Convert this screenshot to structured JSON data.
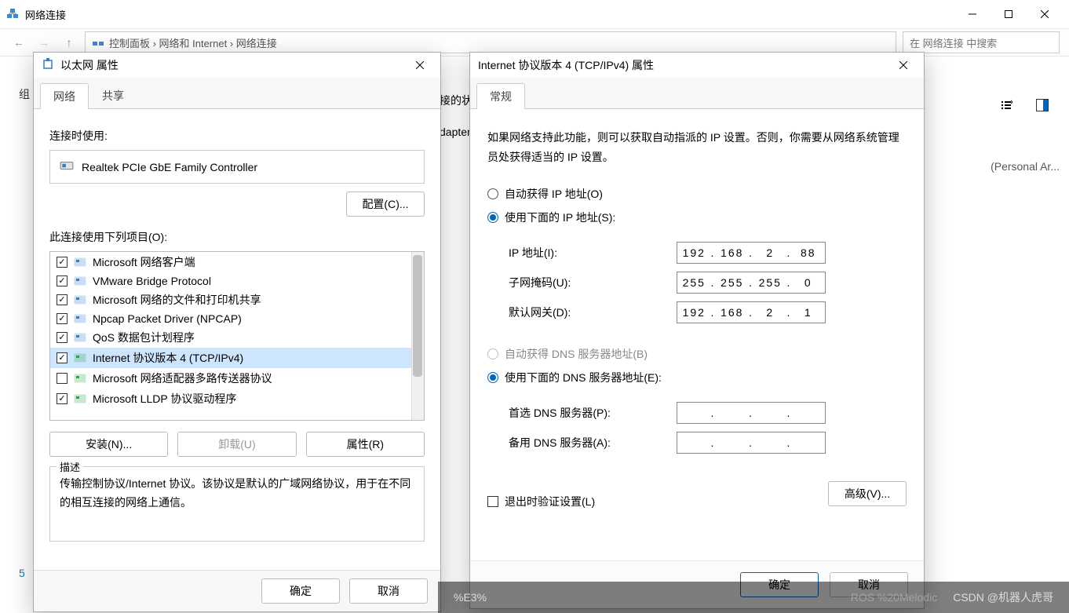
{
  "window": {
    "title": "网络连接",
    "min": "—",
    "max": "☐",
    "close": "✕"
  },
  "breadcrumb_hint": "控制面板 › 网络和 Internet › 网络连接",
  "search_placeholder": "在 网络连接 中搜索",
  "truncated_left": "组",
  "truncated_status": "接的状",
  "right_panel_text": "(Personal Ar...",
  "left_number": "5",
  "adapter_word": "dapter",
  "eth_dialog": {
    "title": "以太网 属性",
    "tabs": {
      "network": "网络",
      "share": "共享"
    },
    "connect_using": "连接时使用:",
    "adapter_name": "Realtek PCIe GbE Family Controller",
    "configure_btn": "配置(C)...",
    "items_label": "此连接使用下列项目(O):",
    "items": [
      {
        "checked": true,
        "label": "Microsoft 网络客户端",
        "color": "#2e7dd6"
      },
      {
        "checked": true,
        "label": "VMware Bridge Protocol",
        "color": "#2e7dd6"
      },
      {
        "checked": true,
        "label": "Microsoft 网络的文件和打印机共享",
        "color": "#2e7dd6"
      },
      {
        "checked": true,
        "label": "Npcap Packet Driver (NPCAP)",
        "color": "#2e7dd6"
      },
      {
        "checked": true,
        "label": "QoS 数据包计划程序",
        "color": "#2e7dd6"
      },
      {
        "checked": true,
        "label": "Internet 协议版本 4 (TCP/IPv4)",
        "color": "#22aa44",
        "selected": true
      },
      {
        "checked": false,
        "label": "Microsoft 网络适配器多路传送器协议",
        "color": "#22aa44"
      },
      {
        "checked": true,
        "label": "Microsoft LLDP 协议驱动程序",
        "color": "#22aa44"
      }
    ],
    "install_btn": "安装(N)...",
    "uninstall_btn": "卸载(U)",
    "properties_btn": "属性(R)",
    "desc_label": "描述",
    "desc_text": "传输控制协议/Internet 协议。该协议是默认的广域网络协议，用于在不同的相互连接的网络上通信。",
    "ok": "确定",
    "cancel": "取消"
  },
  "ipv4_dialog": {
    "title": "Internet 协议版本 4 (TCP/IPv4) 属性",
    "tab": "常规",
    "intro": "如果网络支持此功能，则可以获取自动指派的 IP 设置。否则，你需要从网络系统管理员处获得适当的 IP 设置。",
    "radio_auto_ip": "自动获得 IP 地址(O)",
    "radio_manual_ip": "使用下面的 IP 地址(S):",
    "ip_label": "IP 地址(I):",
    "ip_value": [
      "192",
      "168",
      "2",
      "88"
    ],
    "mask_label": "子网掩码(U):",
    "mask_value": [
      "255",
      "255",
      "255",
      "0"
    ],
    "gw_label": "默认网关(D):",
    "gw_value": [
      "192",
      "168",
      "2",
      "1"
    ],
    "radio_auto_dns": "自动获得 DNS 服务器地址(B)",
    "radio_manual_dns": "使用下面的 DNS 服务器地址(E):",
    "dns1_label": "首选 DNS 服务器(P):",
    "dns1_value": [
      "",
      "",
      "",
      ""
    ],
    "dns2_label": "备用 DNS 服务器(A):",
    "dns2_value": [
      "",
      "",
      "",
      ""
    ],
    "validate_label": "退出时验证设置(L)",
    "advanced_btn": "高级(V)...",
    "ok": "确定",
    "cancel": "取消"
  },
  "watermark": {
    "left_hint": "%E3%",
    "right": "CSDN @机器人虎哥",
    "mid": "ROS  %20Melodic"
  }
}
